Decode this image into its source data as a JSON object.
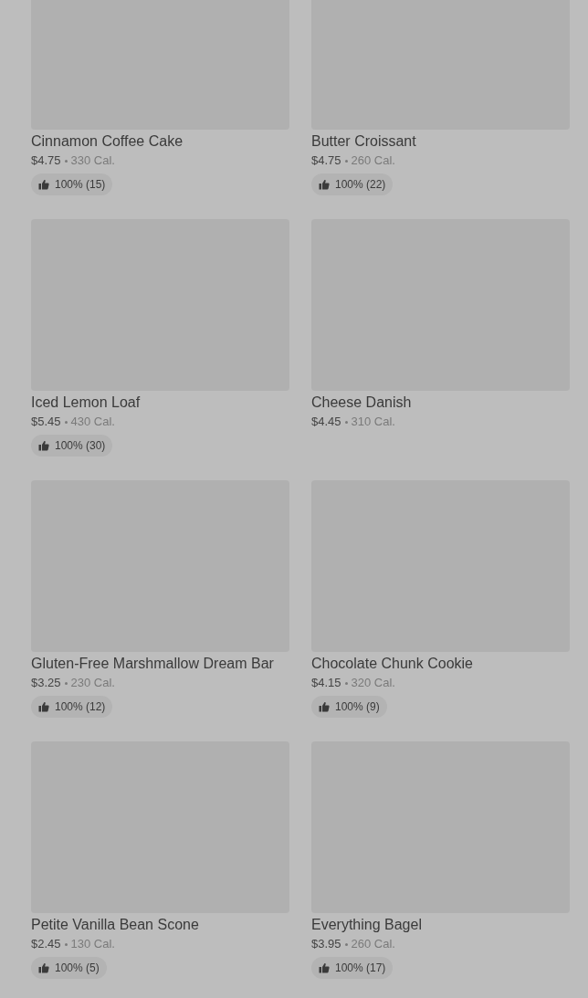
{
  "items": [
    {
      "name": "Cinnamon Coffee Cake",
      "price": "$4.75",
      "calories": "330 Cal.",
      "rating": "100% (15)"
    },
    {
      "name": "Butter Croissant",
      "price": "$4.75",
      "calories": "260 Cal.",
      "rating": "100% (22)"
    },
    {
      "name": "Iced Lemon Loaf",
      "price": "$5.45",
      "calories": "430 Cal.",
      "rating": "100% (30)"
    },
    {
      "name": "Cheese Danish",
      "price": "$4.45",
      "calories": "310 Cal."
    },
    {
      "name": "Gluten-Free Marshmallow Dream Bar",
      "price": "$3.25",
      "calories": "230 Cal.",
      "rating": "100% (12)"
    },
    {
      "name": "Chocolate Chunk Cookie",
      "price": "$4.15",
      "calories": "320 Cal.",
      "rating": "100% (9)"
    },
    {
      "name": "Petite Vanilla Bean Scone",
      "price": "$2.45",
      "calories": "130 Cal.",
      "rating": "100% (5)"
    },
    {
      "name": "Everything Bagel",
      "price": "$3.95",
      "calories": "260 Cal.",
      "rating": "100% (17)"
    }
  ]
}
